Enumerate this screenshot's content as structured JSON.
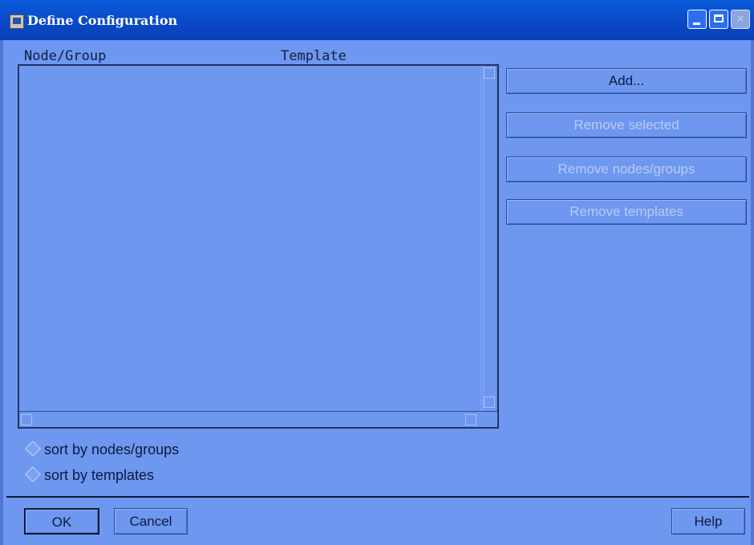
{
  "window": {
    "title": "Define Configuration",
    "icon": "app-icon"
  },
  "columns": {
    "node_group": "Node/Group",
    "template": "Template"
  },
  "list": {
    "rows": []
  },
  "actions": {
    "add": "Add...",
    "remove_selected": "Remove selected",
    "remove_nodes_groups": "Remove nodes/groups",
    "remove_templates": "Remove templates"
  },
  "sort": {
    "by_nodes_groups": "sort by nodes/groups",
    "by_templates": "sort by templates"
  },
  "footer": {
    "ok": "OK",
    "cancel": "Cancel",
    "help": "Help"
  }
}
